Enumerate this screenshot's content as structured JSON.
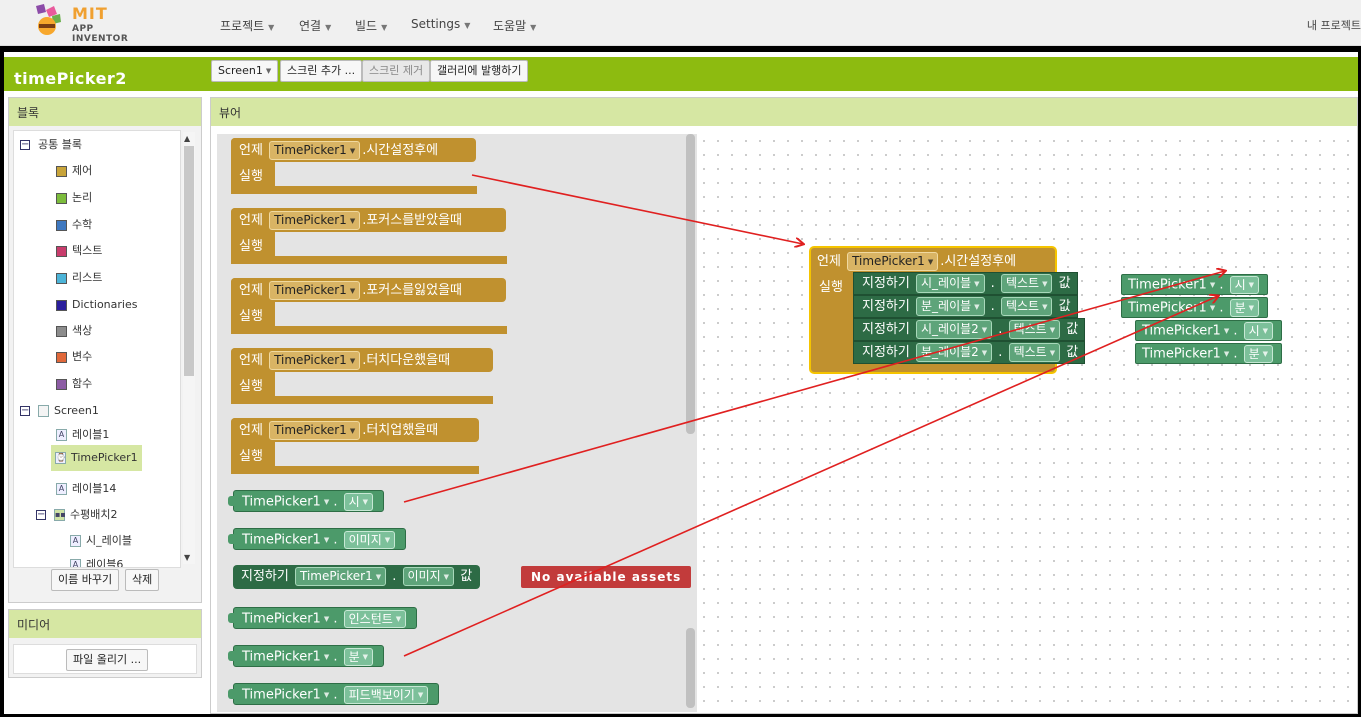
{
  "logo": {
    "brand": "MIT",
    "sub": "APP INVENTOR"
  },
  "nav": {
    "items": [
      "프로젝트",
      "연결",
      "빌드",
      "Settings",
      "도움말"
    ],
    "right": "내 프로젝트"
  },
  "project": {
    "title": "timePicker2"
  },
  "toolbar": {
    "screen_select": "Screen1",
    "add_screen": "스크린 추가 ...",
    "remove_screen": "스크린 제거",
    "publish_gallery": "갤러리에 발행하기"
  },
  "blocks_panel": {
    "header": "블록",
    "builtin_label": "공통 블록",
    "builtin": [
      {
        "label": "제어",
        "color": "#c8a43a"
      },
      {
        "label": "논리",
        "color": "#7cbc3c"
      },
      {
        "label": "수학",
        "color": "#3e78c0"
      },
      {
        "label": "텍스트",
        "color": "#c83c6c"
      },
      {
        "label": "리스트",
        "color": "#4cb4d8"
      },
      {
        "label": "Dictionaries",
        "color": "#2a1e9c"
      },
      {
        "label": "색상",
        "color": "#8c8c8c"
      },
      {
        "label": "변수",
        "color": "#e0683a"
      },
      {
        "label": "함수",
        "color": "#8c5ca4"
      }
    ],
    "screen": "Screen1",
    "components": [
      "레이블1",
      "TimePicker1",
      "레이블14"
    ],
    "arrangement": "수평배치2",
    "arrangement_children": [
      "시_레이블",
      "레이블6"
    ],
    "rename_button": "이름 바꾸기",
    "delete_button": "삭제"
  },
  "media_panel": {
    "header": "미디어",
    "upload_button": "파일 올리기 ..."
  },
  "viewer": {
    "header": "뷰어"
  },
  "drawer": {
    "events": [
      {
        "when": "언제",
        "component": "TimePicker1",
        "event": ".시간설정후에",
        "do": "실행"
      },
      {
        "when": "언제",
        "component": "TimePicker1",
        "event": ".포커스를받았을때",
        "do": "실행"
      },
      {
        "when": "언제",
        "component": "TimePicker1",
        "event": ".포커스를잃었을때",
        "do": "실행"
      },
      {
        "when": "언제",
        "component": "TimePicker1",
        "event": ".터치다운했을때",
        "do": "실행"
      },
      {
        "when": "언제",
        "component": "TimePicker1",
        "event": ".터치업했을때",
        "do": "실행"
      }
    ],
    "getters": [
      {
        "component": "TimePicker1",
        "property": "시"
      },
      {
        "component": "TimePicker1",
        "property": "이미지"
      },
      {
        "component": "TimePicker1",
        "property": "인스턴트"
      },
      {
        "component": "TimePicker1",
        "property": "분"
      },
      {
        "component": "TimePicker1",
        "property": "피드백보이기"
      }
    ],
    "setter": {
      "set": "지정하기",
      "component": "TimePicker1",
      "property": "이미지",
      "to": "값",
      "value": "No available assets"
    }
  },
  "workspace": {
    "event": {
      "when": "언제",
      "component": "TimePicker1",
      "event": ".시간설정후에",
      "do": "실행"
    },
    "rows": [
      {
        "set": "지정하기",
        "target": "시_레이블",
        "property": "텍스트",
        "to": "값",
        "component": "TimePicker1",
        "value_property": "시"
      },
      {
        "set": "지정하기",
        "target": "분_레이블",
        "property": "텍스트",
        "to": "값",
        "component": "TimePicker1",
        "value_property": "분"
      },
      {
        "set": "지정하기",
        "target": "시_레이블2",
        "property": "텍스트",
        "to": "값",
        "component": "TimePicker1",
        "value_property": "시"
      },
      {
        "set": "지정하기",
        "target": "분_레이블2",
        "property": "텍스트",
        "to": "값",
        "component": "TimePicker1",
        "value_property": "분"
      }
    ]
  },
  "colors": {
    "accent": "#8dbb10",
    "event_block": "#c0912f",
    "component_block": "#4c9a6a",
    "setter_block": "#2d6b45",
    "arrow": "#e02020"
  }
}
